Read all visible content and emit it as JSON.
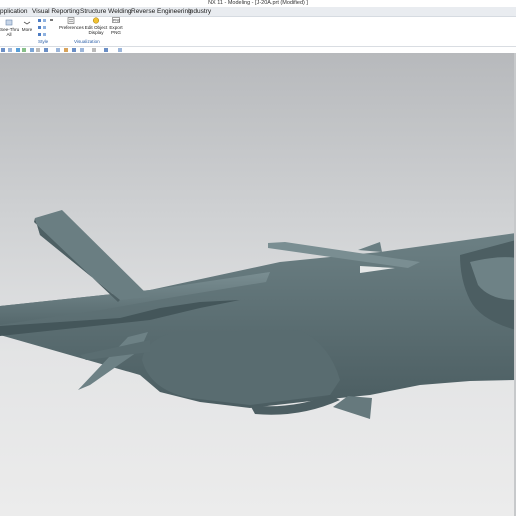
{
  "window": {
    "title": "NX 11 - Modeling - [J-20A.prt (Modified) ]"
  },
  "menu": [
    {
      "label": "pplication"
    },
    {
      "label": "Visual Reporting"
    },
    {
      "label": "Structure Welding"
    },
    {
      "label": "Reverse Engineering"
    },
    {
      "label": "Industry"
    }
  ],
  "ribbon": {
    "see_thru_label": "See-Thru\nAll",
    "more_label": "More",
    "preferences_label": "Preferences",
    "edit_object_display_label": "Edit Object\nDisplay",
    "export_png_label": "Export\nPNG",
    "style_group": "Style",
    "visualization_group": "Visualization"
  },
  "colors": {
    "accent": "#2a5ea8",
    "model": "#5f7377",
    "viewport_top": "#b7b9bc"
  }
}
